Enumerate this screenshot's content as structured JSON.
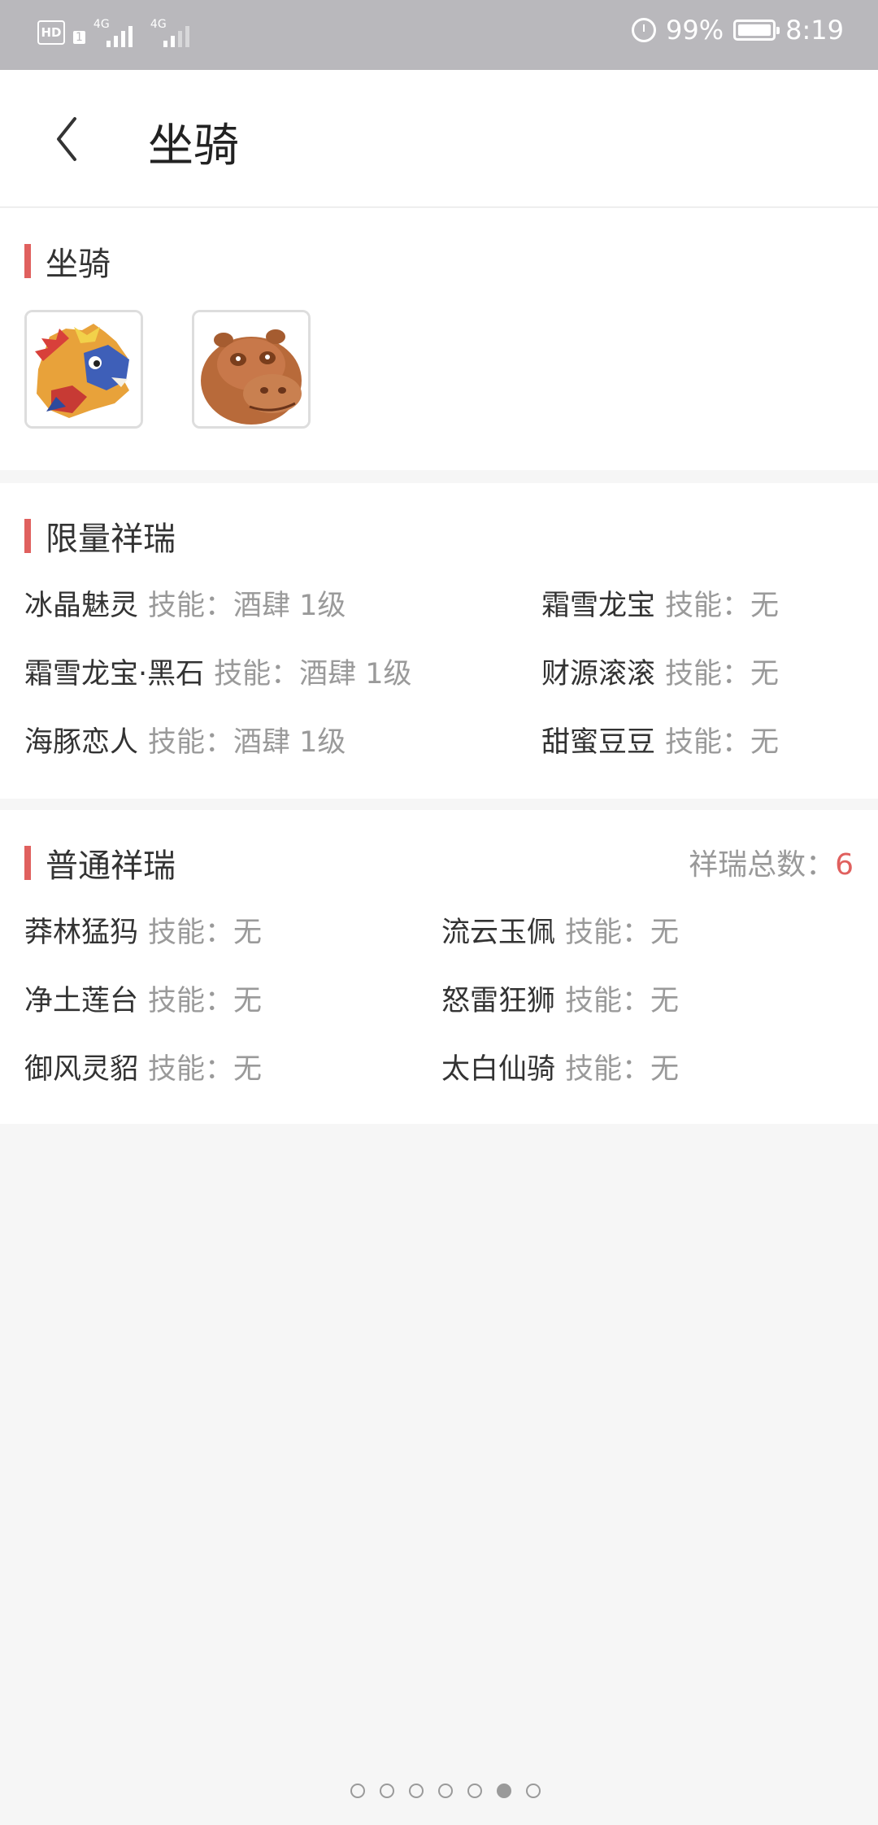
{
  "status_bar": {
    "hd": "HD",
    "sim": "1",
    "net1": "4G",
    "net2": "4G",
    "battery": "99%",
    "time": "8:19"
  },
  "header": {
    "title": "坐骑"
  },
  "mounts_section": {
    "title": "坐骑",
    "mounts": [
      {
        "icon": "dragon-mount-icon"
      },
      {
        "icon": "hippo-mount-icon"
      }
    ]
  },
  "limited_section": {
    "title": "限量祥瑞",
    "items": [
      {
        "name": "冰晶魅灵",
        "skill": "技能：酒肆 1级"
      },
      {
        "name": "霜雪龙宝",
        "skill": "技能：无"
      },
      {
        "name": "霜雪龙宝·黑石",
        "skill": "技能：酒肆 1级"
      },
      {
        "name": "财源滚滚",
        "skill": "技能：无"
      },
      {
        "name": "海豚恋人",
        "skill": "技能：酒肆 1级"
      },
      {
        "name": "甜蜜豆豆",
        "skill": "技能：无"
      }
    ]
  },
  "normal_section": {
    "title": "普通祥瑞",
    "total_label": "祥瑞总数：",
    "total_value": "6",
    "items": [
      {
        "name": "莽林猛犸",
        "skill": "技能：无"
      },
      {
        "name": "流云玉佩",
        "skill": "技能：无"
      },
      {
        "name": "净土莲台",
        "skill": "技能：无"
      },
      {
        "name": "怒雷狂狮",
        "skill": "技能：无"
      },
      {
        "name": "御风灵貂",
        "skill": "技能：无"
      },
      {
        "name": "太白仙骑",
        "skill": "技能：无"
      }
    ]
  },
  "pager": {
    "count": 7,
    "active_index": 5
  },
  "colors": {
    "accent": "#e0605e",
    "status_bar": "#b9b8bc",
    "muted_text": "#9a9a9a"
  }
}
